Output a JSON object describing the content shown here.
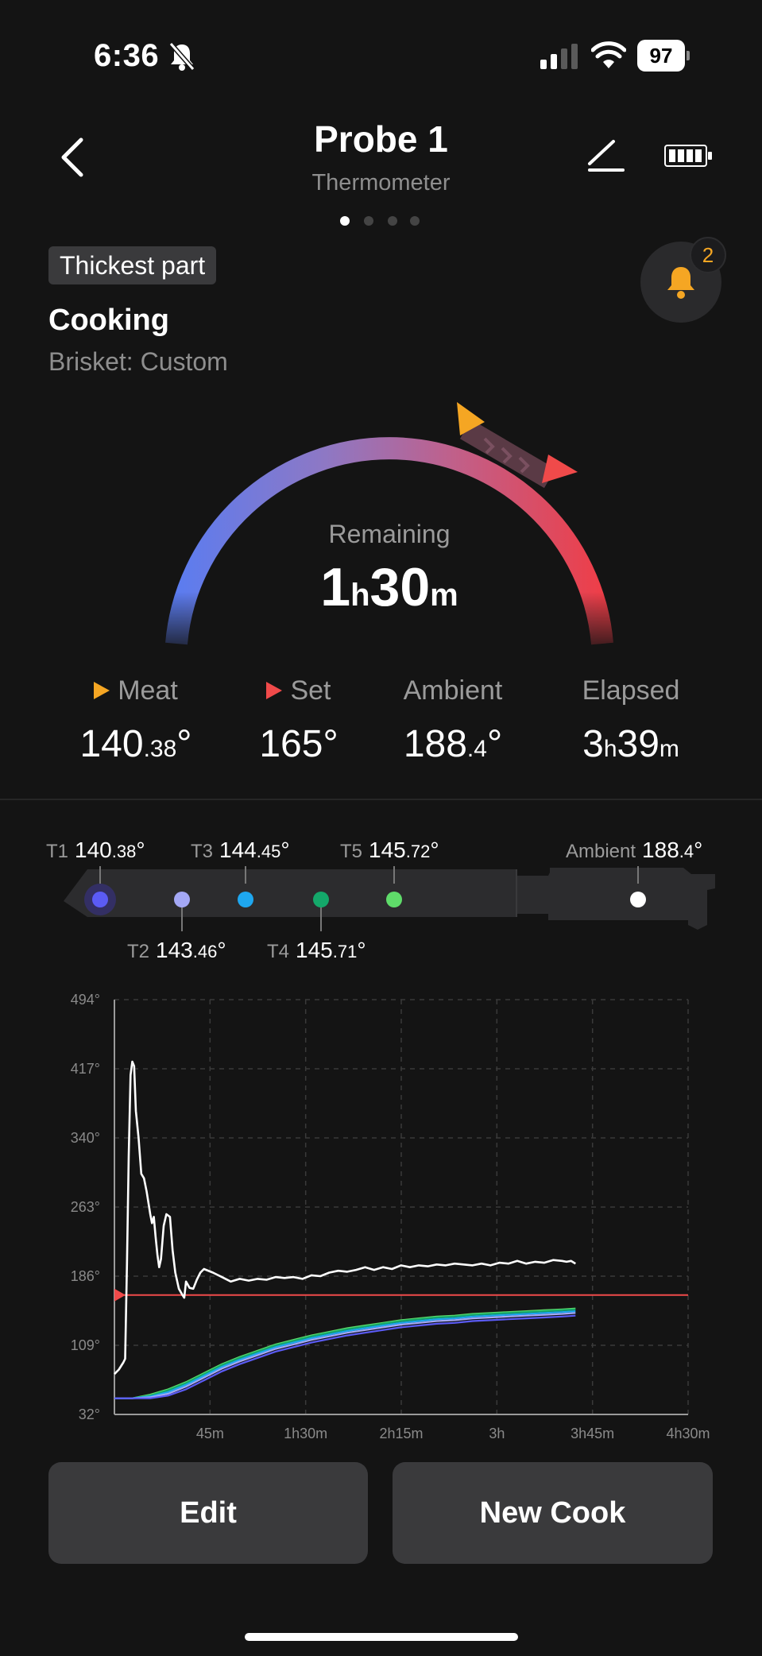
{
  "status_bar": {
    "time": "6:36",
    "battery": "97"
  },
  "header": {
    "title": "Probe 1",
    "subtitle": "Thermometer",
    "page_count": 4,
    "active_page": 0
  },
  "location_badge": "Thickest part",
  "cook": {
    "status": "Cooking",
    "preset": "Brisket: Custom"
  },
  "alerts": {
    "count": "2"
  },
  "gauge": {
    "label": "Remaining",
    "hours": "1",
    "hours_unit": "h",
    "minutes": "30",
    "minutes_unit": "m"
  },
  "stats": {
    "meat": {
      "label": "Meat",
      "value_main": "140",
      "value_dec": ".38",
      "value_unit": "°"
    },
    "set": {
      "label": "Set",
      "value": "165°"
    },
    "ambient": {
      "label": "Ambient",
      "value_main": "188",
      "value_dec": ".4",
      "value_unit": "°"
    },
    "elapsed": {
      "label": "Elapsed",
      "hours": "3",
      "hours_unit": "h",
      "minutes": "39",
      "minutes_unit": "m"
    }
  },
  "sensors": {
    "t1": {
      "label": "T1",
      "main": "140",
      "dec": ".38",
      "unit": "°",
      "color": "#5b5bf5"
    },
    "t2": {
      "label": "T2",
      "main": "143",
      "dec": ".46",
      "unit": "°",
      "color": "#a4a8f5"
    },
    "t3": {
      "label": "T3",
      "main": "144",
      "dec": ".45",
      "unit": "°",
      "color": "#1ea7f0"
    },
    "t4": {
      "label": "T4",
      "main": "145",
      "dec": ".71",
      "unit": "°",
      "color": "#14a86a"
    },
    "t5": {
      "label": "T5",
      "main": "145",
      "dec": ".72",
      "unit": "°",
      "color": "#5fdc6a"
    },
    "ambient": {
      "label": "Ambient",
      "main": "188",
      "dec": ".4",
      "unit": "°",
      "color": "#ffffff"
    }
  },
  "colors": {
    "meat": "#f5a623",
    "set": "#f04a4a",
    "ambient_line": "#ffffff"
  },
  "chart_data": {
    "type": "line",
    "y_ticks": [
      "494°",
      "417°",
      "340°",
      "263°",
      "186°",
      "109°",
      "32°"
    ],
    "x_ticks": [
      "45m",
      "1h30m",
      "2h15m",
      "3h",
      "3h45m",
      "4h30m"
    ],
    "ylim": [
      32,
      494
    ],
    "xlim_min": [
      0,
      270
    ],
    "set_value": 165,
    "series": [
      {
        "color": "#ffffff",
        "points": [
          [
            0,
            77
          ],
          [
            5,
            82
          ],
          [
            10,
            90
          ],
          [
            12,
            94
          ],
          [
            14,
            200
          ],
          [
            16,
            320
          ],
          [
            18,
            410
          ],
          [
            20,
            425
          ],
          [
            22,
            420
          ],
          [
            24,
            370
          ],
          [
            27,
            340
          ],
          [
            30,
            300
          ],
          [
            33,
            295
          ],
          [
            36,
            280
          ],
          [
            40,
            255
          ],
          [
            42,
            245
          ],
          [
            44,
            252
          ],
          [
            46,
            230
          ],
          [
            48,
            210
          ],
          [
            50,
            196
          ],
          [
            52,
            205
          ],
          [
            55,
            242
          ],
          [
            58,
            255
          ],
          [
            62,
            252
          ],
          [
            65,
            215
          ],
          [
            68,
            190
          ],
          [
            72,
            172
          ],
          [
            76,
            165
          ],
          [
            78,
            162
          ],
          [
            80,
            180
          ],
          [
            84,
            173
          ],
          [
            88,
            172
          ],
          [
            92,
            182
          ],
          [
            96,
            190
          ],
          [
            100,
            194
          ],
          [
            110,
            190
          ],
          [
            120,
            185
          ],
          [
            130,
            180
          ],
          [
            140,
            183
          ],
          [
            150,
            181
          ],
          [
            160,
            183
          ],
          [
            170,
            182
          ],
          [
            180,
            185
          ],
          [
            190,
            184
          ],
          [
            200,
            185
          ],
          [
            210,
            183
          ],
          [
            220,
            187
          ],
          [
            230,
            186
          ],
          [
            240,
            190
          ],
          [
            250,
            192
          ],
          [
            260,
            191
          ],
          [
            270,
            193
          ],
          [
            280,
            196
          ],
          [
            290,
            193
          ],
          [
            300,
            196
          ],
          [
            310,
            194
          ],
          [
            320,
            198
          ],
          [
            330,
            196
          ],
          [
            340,
            198
          ],
          [
            350,
            197
          ],
          [
            360,
            199
          ],
          [
            370,
            198
          ],
          [
            380,
            200
          ],
          [
            390,
            199
          ],
          [
            400,
            198
          ],
          [
            410,
            200
          ],
          [
            420,
            198
          ],
          [
            430,
            201
          ],
          [
            440,
            200
          ],
          [
            450,
            203
          ],
          [
            460,
            200
          ],
          [
            470,
            202
          ],
          [
            480,
            201
          ],
          [
            490,
            204
          ],
          [
            500,
            203
          ],
          [
            505,
            202
          ],
          [
            510,
            203
          ],
          [
            515,
            200
          ]
        ]
      }
    ],
    "probe_series": [
      {
        "name": "T5",
        "color": "#5fdc6a",
        "points": [
          [
            0,
            50
          ],
          [
            20,
            50
          ],
          [
            40,
            54
          ],
          [
            60,
            60
          ],
          [
            80,
            68
          ],
          [
            100,
            78
          ],
          [
            120,
            88
          ],
          [
            140,
            96
          ],
          [
            160,
            103
          ],
          [
            180,
            110
          ],
          [
            200,
            115
          ],
          [
            220,
            120
          ],
          [
            240,
            124
          ],
          [
            260,
            128
          ],
          [
            280,
            131
          ],
          [
            300,
            134
          ],
          [
            320,
            137
          ],
          [
            340,
            139
          ],
          [
            360,
            141
          ],
          [
            380,
            142
          ],
          [
            400,
            144
          ],
          [
            420,
            145
          ],
          [
            440,
            146
          ],
          [
            460,
            147
          ],
          [
            480,
            148
          ],
          [
            500,
            149
          ],
          [
            515,
            150
          ]
        ]
      },
      {
        "name": "T4",
        "color": "#14a86a",
        "points": [
          [
            0,
            50
          ],
          [
            20,
            50
          ],
          [
            40,
            53
          ],
          [
            60,
            59
          ],
          [
            80,
            67
          ],
          [
            100,
            77
          ],
          [
            120,
            87
          ],
          [
            140,
            95
          ],
          [
            160,
            102
          ],
          [
            180,
            109
          ],
          [
            200,
            114
          ],
          [
            220,
            119
          ],
          [
            240,
            123
          ],
          [
            260,
            127
          ],
          [
            280,
            130
          ],
          [
            300,
            133
          ],
          [
            320,
            136
          ],
          [
            340,
            138
          ],
          [
            360,
            140
          ],
          [
            380,
            141
          ],
          [
            400,
            143
          ],
          [
            420,
            144
          ],
          [
            440,
            145
          ],
          [
            460,
            146
          ],
          [
            480,
            147
          ],
          [
            500,
            148
          ],
          [
            515,
            149
          ]
        ]
      },
      {
        "name": "T3",
        "color": "#1ea7f0",
        "points": [
          [
            0,
            50
          ],
          [
            20,
            50
          ],
          [
            40,
            52
          ],
          [
            60,
            57
          ],
          [
            80,
            65
          ],
          [
            100,
            75
          ],
          [
            120,
            85
          ],
          [
            140,
            93
          ],
          [
            160,
            100
          ],
          [
            180,
            107
          ],
          [
            200,
            112
          ],
          [
            220,
            117
          ],
          [
            240,
            121
          ],
          [
            260,
            125
          ],
          [
            280,
            128
          ],
          [
            300,
            131
          ],
          [
            320,
            134
          ],
          [
            340,
            136
          ],
          [
            360,
            138
          ],
          [
            380,
            139
          ],
          [
            400,
            141
          ],
          [
            420,
            142
          ],
          [
            440,
            143
          ],
          [
            460,
            144
          ],
          [
            480,
            145
          ],
          [
            500,
            146
          ],
          [
            515,
            147
          ]
        ]
      },
      {
        "name": "T2",
        "color": "#a4a8f5",
        "points": [
          [
            0,
            50
          ],
          [
            20,
            50
          ],
          [
            40,
            51
          ],
          [
            60,
            55
          ],
          [
            80,
            63
          ],
          [
            100,
            73
          ],
          [
            120,
            83
          ],
          [
            140,
            91
          ],
          [
            160,
            98
          ],
          [
            180,
            105
          ],
          [
            200,
            110
          ],
          [
            220,
            115
          ],
          [
            240,
            119
          ],
          [
            260,
            123
          ],
          [
            280,
            126
          ],
          [
            300,
            129
          ],
          [
            320,
            132
          ],
          [
            340,
            134
          ],
          [
            360,
            136
          ],
          [
            380,
            137
          ],
          [
            400,
            139
          ],
          [
            420,
            140
          ],
          [
            440,
            141
          ],
          [
            460,
            142
          ],
          [
            480,
            143
          ],
          [
            500,
            144
          ],
          [
            515,
            145
          ]
        ]
      },
      {
        "name": "T1",
        "color": "#5b5bf5",
        "points": [
          [
            0,
            50
          ],
          [
            20,
            50
          ],
          [
            40,
            50
          ],
          [
            60,
            53
          ],
          [
            80,
            60
          ],
          [
            100,
            70
          ],
          [
            120,
            80
          ],
          [
            140,
            88
          ],
          [
            160,
            95
          ],
          [
            180,
            102
          ],
          [
            200,
            107
          ],
          [
            220,
            112
          ],
          [
            240,
            116
          ],
          [
            260,
            120
          ],
          [
            280,
            123
          ],
          [
            300,
            126
          ],
          [
            320,
            129
          ],
          [
            340,
            131
          ],
          [
            360,
            133
          ],
          [
            380,
            134
          ],
          [
            400,
            136
          ],
          [
            420,
            137
          ],
          [
            440,
            138
          ],
          [
            460,
            139
          ],
          [
            480,
            140
          ],
          [
            500,
            141
          ],
          [
            515,
            142
          ]
        ]
      }
    ]
  },
  "actions": {
    "edit": "Edit",
    "new_cook": "New Cook"
  }
}
